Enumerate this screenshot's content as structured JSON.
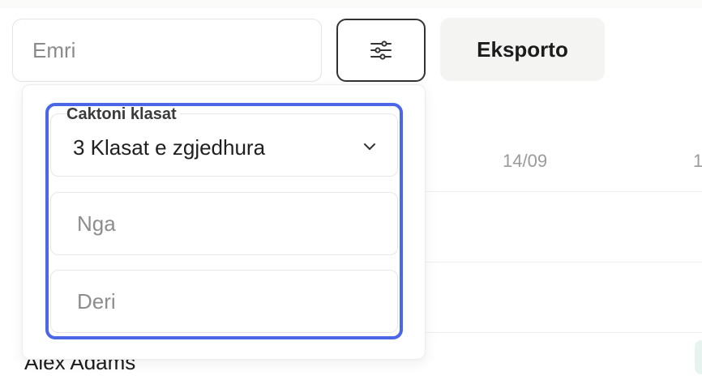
{
  "search": {
    "placeholder": "Emri"
  },
  "toolbar": {
    "filter_icon": "sliders-icon",
    "export_label": "Eksporto"
  },
  "table": {
    "columns": [
      "14/09",
      "1"
    ],
    "rows": [
      {
        "name": "Alex Adams"
      }
    ]
  },
  "filters": {
    "classes_label": "Caktoni klasat",
    "classes_value": "3 Klasat e zgjedhura",
    "from_placeholder": "Nga",
    "to_placeholder": "Deri"
  },
  "colors": {
    "highlight": "#4a67e8",
    "export_bg": "#f4f4f3"
  }
}
